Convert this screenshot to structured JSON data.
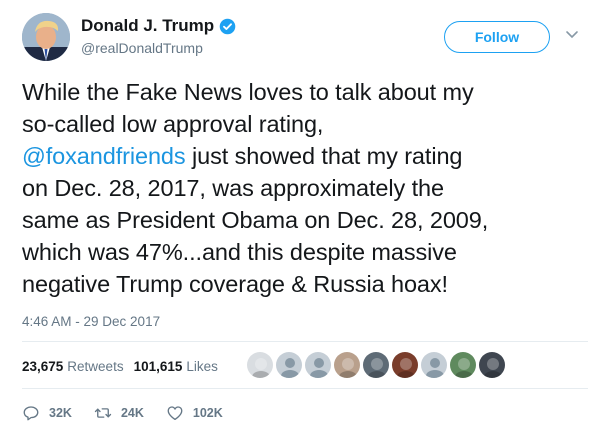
{
  "user": {
    "display_name": "Donald J. Trump",
    "handle": "@realDonaldTrump",
    "verified": true
  },
  "follow_button": {
    "label": "Follow"
  },
  "tweet": {
    "lines": [
      {
        "segments": [
          {
            "text": "While the Fake News loves to talk about my",
            "mention": false
          }
        ]
      },
      {
        "segments": [
          {
            "text": "so-called low approval rating,",
            "mention": false
          }
        ]
      },
      {
        "segments": [
          {
            "text": "@foxandfriends",
            "mention": true
          },
          {
            "text": " just showed that my rating",
            "mention": false
          }
        ]
      },
      {
        "segments": [
          {
            "text": "on Dec. 28, 2017, was approximately the",
            "mention": false
          }
        ]
      },
      {
        "segments": [
          {
            "text": "same as President Obama on Dec. 28, 2009,",
            "mention": false
          }
        ]
      },
      {
        "segments": [
          {
            "text": "which was 47%...and this despite massive",
            "mention": false
          }
        ]
      },
      {
        "segments": [
          {
            "text": "negative Trump coverage & Russia hoax!",
            "mention": false
          }
        ]
      }
    ],
    "timestamp": "4:46 AM - 29 Dec 2017"
  },
  "stats": {
    "retweets_count": "23,675",
    "retweets_label": "Retweets",
    "likes_count": "101,615",
    "likes_label": "Likes"
  },
  "likers": [
    {
      "icon": "liker-avatar-1",
      "color": "#d9dde1"
    },
    {
      "icon": "default-egg-avatar",
      "color": "#c5ced6"
    },
    {
      "icon": "default-egg-avatar",
      "color": "#c5ced6"
    },
    {
      "icon": "liker-avatar-4",
      "color": "#b9a08c"
    },
    {
      "icon": "liker-avatar-5",
      "color": "#5e6b76"
    },
    {
      "icon": "liker-avatar-6",
      "color": "#7a3d2b"
    },
    {
      "icon": "default-egg-avatar",
      "color": "#c5ced6"
    },
    {
      "icon": "liker-avatar-8",
      "color": "#5f8a5e"
    },
    {
      "icon": "liker-avatar-9",
      "color": "#3f4650"
    }
  ],
  "actions": {
    "reply_count": "32K",
    "retweet_count": "24K",
    "like_count": "102K"
  },
  "colors": {
    "brand_blue": "#1da1f2",
    "mention_blue": "#1b95e0",
    "secondary_text": "#657786",
    "divider": "#e6ecf0"
  }
}
